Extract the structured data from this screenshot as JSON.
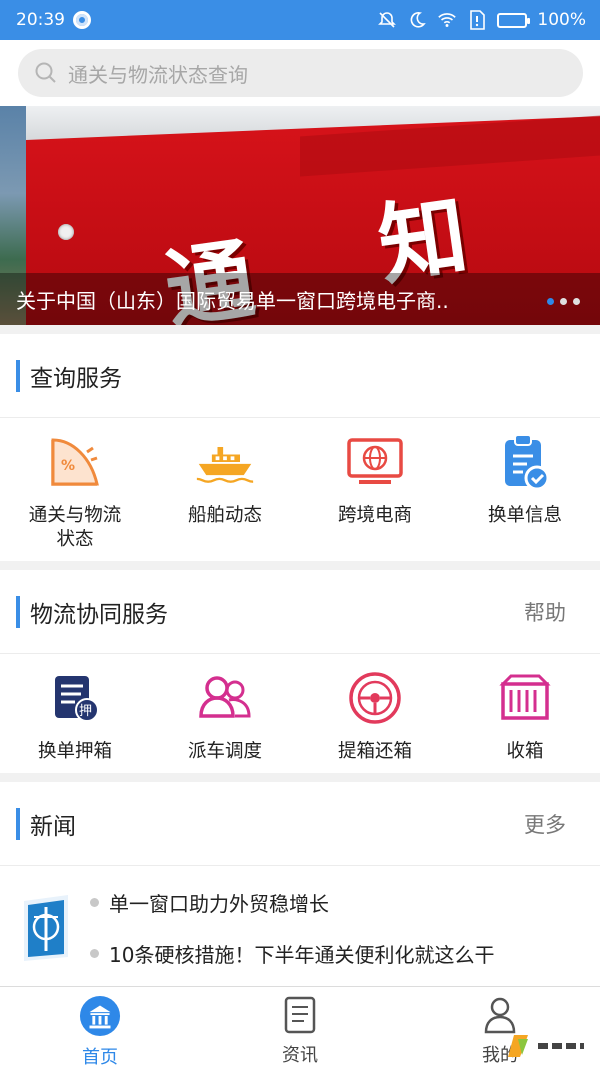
{
  "status_bar": {
    "time": "20:39",
    "battery": "100%"
  },
  "search": {
    "placeholder": "通关与物流状态查询"
  },
  "banner": {
    "sign_chars": [
      "通",
      "知"
    ],
    "caption": "关于中国（山东）国际贸易单一窗口跨境电子商..",
    "dots_count": 3,
    "active_dot": 0
  },
  "query_services": {
    "title": "查询服务",
    "items": [
      {
        "label_lines": [
          "通关与物流",
          "状态"
        ],
        "icon": "customs-chart-icon"
      },
      {
        "label_lines": [
          "船舶动态"
        ],
        "icon": "ship-icon"
      },
      {
        "label_lines": [
          "跨境电商"
        ],
        "icon": "globe-monitor-icon"
      },
      {
        "label_lines": [
          "换单信息"
        ],
        "icon": "clipboard-check-icon"
      }
    ]
  },
  "logistics_services": {
    "title": "物流协同服务",
    "help_label": "帮助",
    "items": [
      {
        "label": "换单押箱",
        "icon": "document-deposit-icon",
        "badge": "押"
      },
      {
        "label": "派车调度",
        "icon": "people-icon"
      },
      {
        "label": "提箱还箱",
        "icon": "steering-wheel-icon"
      },
      {
        "label": "收箱",
        "icon": "container-icon"
      }
    ]
  },
  "news": {
    "title": "新闻",
    "more_label": "更多",
    "items": [
      "单一窗口助力外贸稳增长",
      "10条硬核措施！下半年通关便利化就这么干"
    ]
  },
  "tabbar": {
    "tabs": [
      {
        "label": "首页",
        "icon": "home-bank-icon",
        "active": true
      },
      {
        "label": "资讯",
        "icon": "news-doc-icon",
        "active": false
      },
      {
        "label": "我的",
        "icon": "user-icon",
        "active": false
      }
    ]
  },
  "colors": {
    "accent": "#3a8ee6",
    "orange": "#f08a3c",
    "magenta": "#d42f8f",
    "navy": "#24356f"
  }
}
